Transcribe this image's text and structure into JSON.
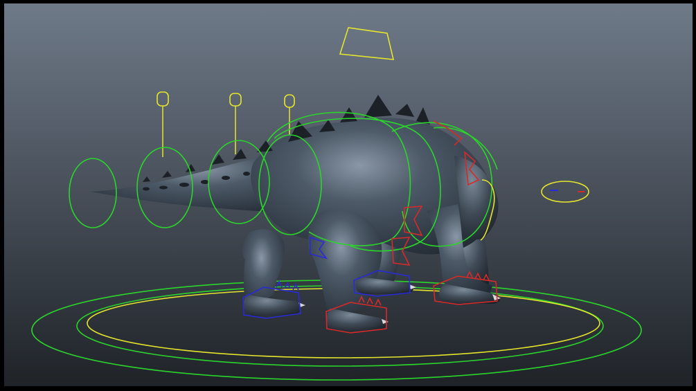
{
  "viewport": {
    "background_top": "#6f7a89",
    "background_bottom": "#22262c",
    "model": "dinosaur",
    "model_color": "#4a5664"
  },
  "controls": {
    "color_main": "#2bd62b",
    "color_aux": "#e6e62b",
    "color_left": "#2a2ad8",
    "color_right": "#d62a2a"
  },
  "icons": {
    "camera": "camera-icon",
    "eye": "eye-control-icon"
  }
}
